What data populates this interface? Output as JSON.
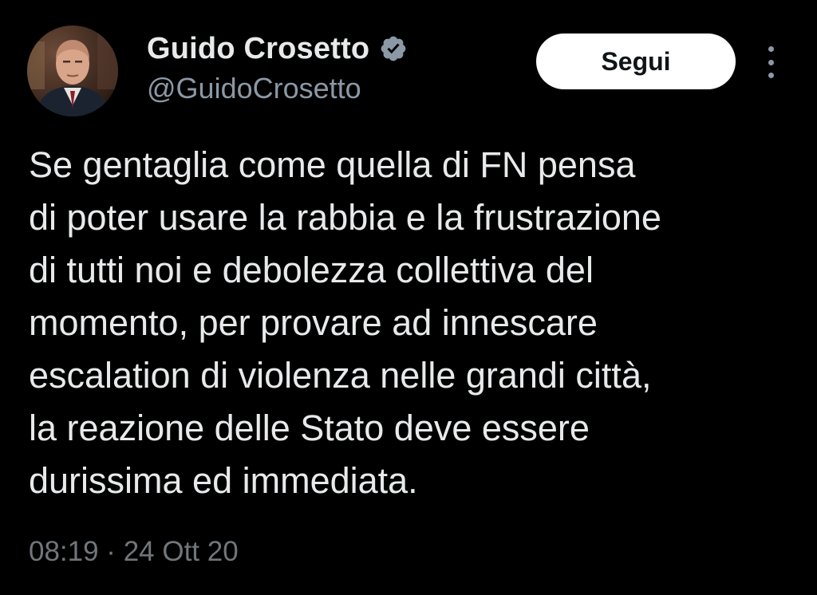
{
  "author": {
    "display_name": "Guido Crosetto",
    "handle": "@GuidoCrosetto",
    "verified_icon": "verified-badge-icon",
    "avatar": "profile-photo"
  },
  "actions": {
    "follow_label": "Segui",
    "more_icon": "more-vertical-icon"
  },
  "tweet": {
    "lines": [
      "Se gentaglia come quella di FN pensa",
      "di poter usare la rabbia e la frustrazione",
      "di tutti noi e debolezza collettiva del",
      "momento, per provare ad innescare",
      "escalation di violenza nelle grandi città,",
      "la reazione delle Stato deve essere",
      "durissima ed immediata."
    ],
    "timestamp": "08:19 · 24 Ott 20"
  },
  "colors": {
    "background": "#000000",
    "primary_text": "#e7e9ea",
    "secondary_text": "#8b98a5",
    "button_bg": "#ffffff",
    "button_text": "#0f1419"
  }
}
